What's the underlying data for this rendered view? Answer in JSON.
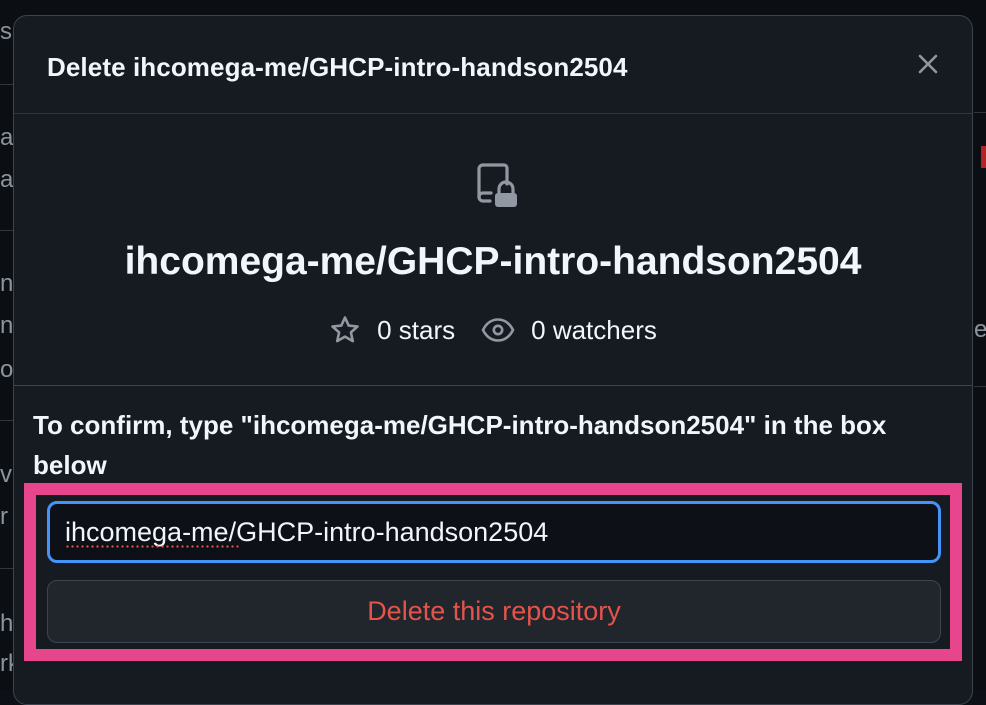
{
  "dialog": {
    "title": "Delete ihcomega-me/GHCP-intro-handson2504",
    "close_icon": "close-icon"
  },
  "repo": {
    "icon": "repo-locked-icon",
    "name": "ihcomega-me/GHCP-intro-handson2504",
    "stars_label": "0 stars",
    "watchers_label": "0 watchers"
  },
  "confirm": {
    "instruction": "To confirm, type \"ihcomega-me/GHCP-intro-handson2504\" in the box below",
    "input_value": "ihcomega-me/GHCP-intro-handson2504",
    "delete_label": "Delete this repository"
  },
  "background_fragments": [
    "s",
    "a",
    "al",
    "n",
    "ns",
    "o",
    "v",
    "r",
    "h",
    "rk",
    "e"
  ],
  "colors": {
    "dialog_bg": "#161b22",
    "danger_text": "#e5534b",
    "focus_border": "#4493f8",
    "highlight": "#e8468c"
  }
}
